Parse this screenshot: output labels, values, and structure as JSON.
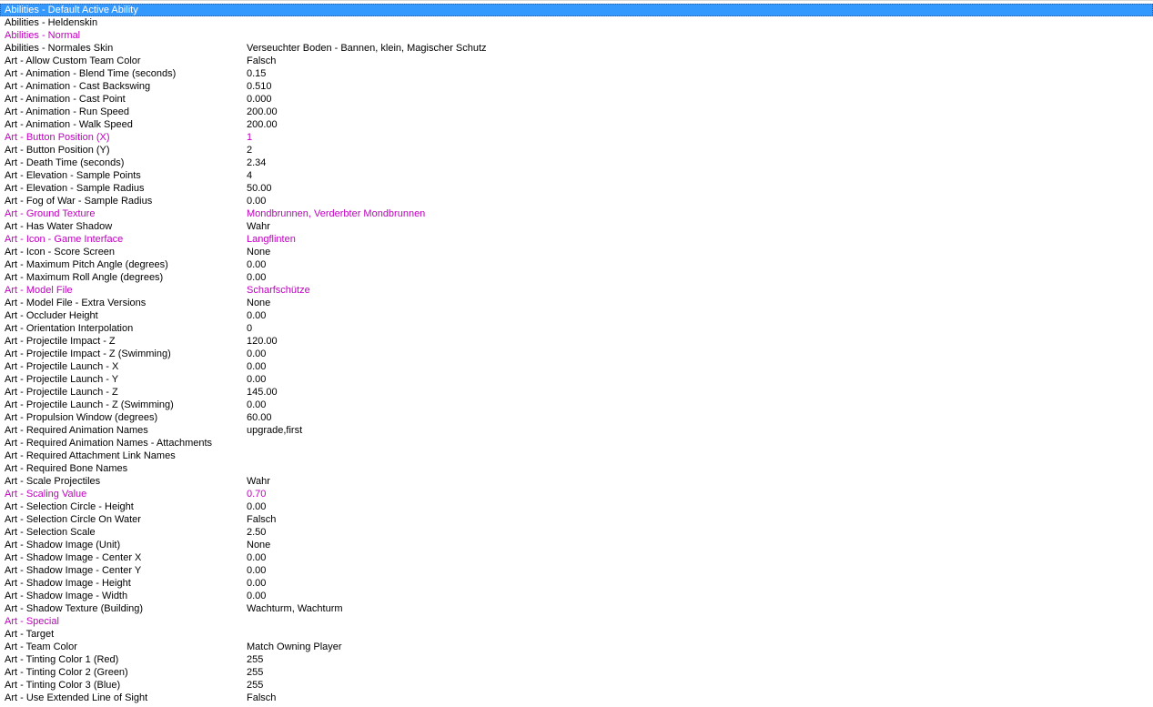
{
  "colors": {
    "selection_bg": "#3399ff",
    "selection_text": "#ffffff",
    "modified_text": "#c000c0",
    "default_text": "#000000"
  },
  "fields": [
    {
      "key": "Abilities - Default Active Ability",
      "value": "",
      "state": "selected"
    },
    {
      "key": "Abilities - Heldenskin",
      "value": "",
      "state": "normal"
    },
    {
      "key": "Abilities - Normal",
      "value": "",
      "state": "modified"
    },
    {
      "key": "Abilities - Normales Skin",
      "value": "Verseuchter Boden - Bannen, klein, Magischer Schutz",
      "state": "normal"
    },
    {
      "key": "Art - Allow Custom Team Color",
      "value": "Falsch",
      "state": "normal"
    },
    {
      "key": "Art - Animation - Blend Time (seconds)",
      "value": "0.15",
      "state": "normal"
    },
    {
      "key": "Art - Animation - Cast Backswing",
      "value": "0.510",
      "state": "normal"
    },
    {
      "key": "Art - Animation - Cast Point",
      "value": "0.000",
      "state": "normal"
    },
    {
      "key": "Art - Animation - Run Speed",
      "value": "200.00",
      "state": "normal"
    },
    {
      "key": "Art - Animation - Walk Speed",
      "value": "200.00",
      "state": "normal"
    },
    {
      "key": "Art - Button Position (X)",
      "value": "1",
      "state": "modified"
    },
    {
      "key": "Art - Button Position (Y)",
      "value": "2",
      "state": "normal"
    },
    {
      "key": "Art - Death Time (seconds)",
      "value": "2.34",
      "state": "normal"
    },
    {
      "key": "Art - Elevation - Sample Points",
      "value": "4",
      "state": "normal"
    },
    {
      "key": "Art - Elevation - Sample Radius",
      "value": "50.00",
      "state": "normal"
    },
    {
      "key": "Art - Fog of War - Sample Radius",
      "value": "0.00",
      "state": "normal"
    },
    {
      "key": "Art - Ground Texture",
      "value": "Mondbrunnen, Verderbter Mondbrunnen",
      "state": "modified"
    },
    {
      "key": "Art - Has Water Shadow",
      "value": "Wahr",
      "state": "normal"
    },
    {
      "key": "Art - Icon - Game Interface",
      "value": "Langflinten",
      "state": "modified"
    },
    {
      "key": "Art - Icon - Score Screen",
      "value": "None",
      "state": "normal"
    },
    {
      "key": "Art - Maximum Pitch Angle (degrees)",
      "value": "0.00",
      "state": "normal"
    },
    {
      "key": "Art - Maximum Roll Angle (degrees)",
      "value": "0.00",
      "state": "normal"
    },
    {
      "key": "Art - Model File",
      "value": "Scharfschütze",
      "state": "modified"
    },
    {
      "key": "Art - Model File - Extra Versions",
      "value": "None",
      "state": "normal"
    },
    {
      "key": "Art - Occluder Height",
      "value": "0.00",
      "state": "normal"
    },
    {
      "key": "Art - Orientation Interpolation",
      "value": "0",
      "state": "normal"
    },
    {
      "key": "Art - Projectile Impact - Z",
      "value": "120.00",
      "state": "normal"
    },
    {
      "key": "Art - Projectile Impact - Z (Swimming)",
      "value": "0.00",
      "state": "normal"
    },
    {
      "key": "Art - Projectile Launch - X",
      "value": "0.00",
      "state": "normal"
    },
    {
      "key": "Art - Projectile Launch - Y",
      "value": "0.00",
      "state": "normal"
    },
    {
      "key": "Art - Projectile Launch - Z",
      "value": "145.00",
      "state": "normal"
    },
    {
      "key": "Art - Projectile Launch - Z (Swimming)",
      "value": "0.00",
      "state": "normal"
    },
    {
      "key": "Art - Propulsion Window (degrees)",
      "value": "60.00",
      "state": "normal"
    },
    {
      "key": "Art - Required Animation Names",
      "value": "upgrade,first",
      "state": "normal"
    },
    {
      "key": "Art - Required Animation Names - Attachments",
      "value": "",
      "state": "normal"
    },
    {
      "key": "Art - Required Attachment Link Names",
      "value": "",
      "state": "normal"
    },
    {
      "key": "Art - Required Bone Names",
      "value": "",
      "state": "normal"
    },
    {
      "key": "Art - Scale Projectiles",
      "value": "Wahr",
      "state": "normal"
    },
    {
      "key": "Art - Scaling Value",
      "value": "0.70",
      "state": "modified"
    },
    {
      "key": "Art - Selection Circle - Height",
      "value": "0.00",
      "state": "normal"
    },
    {
      "key": "Art - Selection Circle On Water",
      "value": "Falsch",
      "state": "normal"
    },
    {
      "key": "Art - Selection Scale",
      "value": "2.50",
      "state": "normal"
    },
    {
      "key": "Art - Shadow Image (Unit)",
      "value": "None",
      "state": "normal"
    },
    {
      "key": "Art - Shadow Image - Center X",
      "value": "0.00",
      "state": "normal"
    },
    {
      "key": "Art - Shadow Image - Center Y",
      "value": "0.00",
      "state": "normal"
    },
    {
      "key": "Art - Shadow Image - Height",
      "value": "0.00",
      "state": "normal"
    },
    {
      "key": "Art - Shadow Image - Width",
      "value": "0.00",
      "state": "normal"
    },
    {
      "key": "Art - Shadow Texture (Building)",
      "value": "Wachturm, Wachturm",
      "state": "normal"
    },
    {
      "key": "Art - Special",
      "value": "",
      "state": "modified"
    },
    {
      "key": "Art - Target",
      "value": "",
      "state": "normal"
    },
    {
      "key": "Art - Team Color",
      "value": "Match Owning Player",
      "state": "normal"
    },
    {
      "key": "Art - Tinting Color 1 (Red)",
      "value": "255",
      "state": "normal"
    },
    {
      "key": "Art - Tinting Color 2 (Green)",
      "value": "255",
      "state": "normal"
    },
    {
      "key": "Art - Tinting Color 3 (Blue)",
      "value": "255",
      "state": "normal"
    },
    {
      "key": "Art - Use Extended Line of Sight",
      "value": "Falsch",
      "state": "normal"
    }
  ]
}
